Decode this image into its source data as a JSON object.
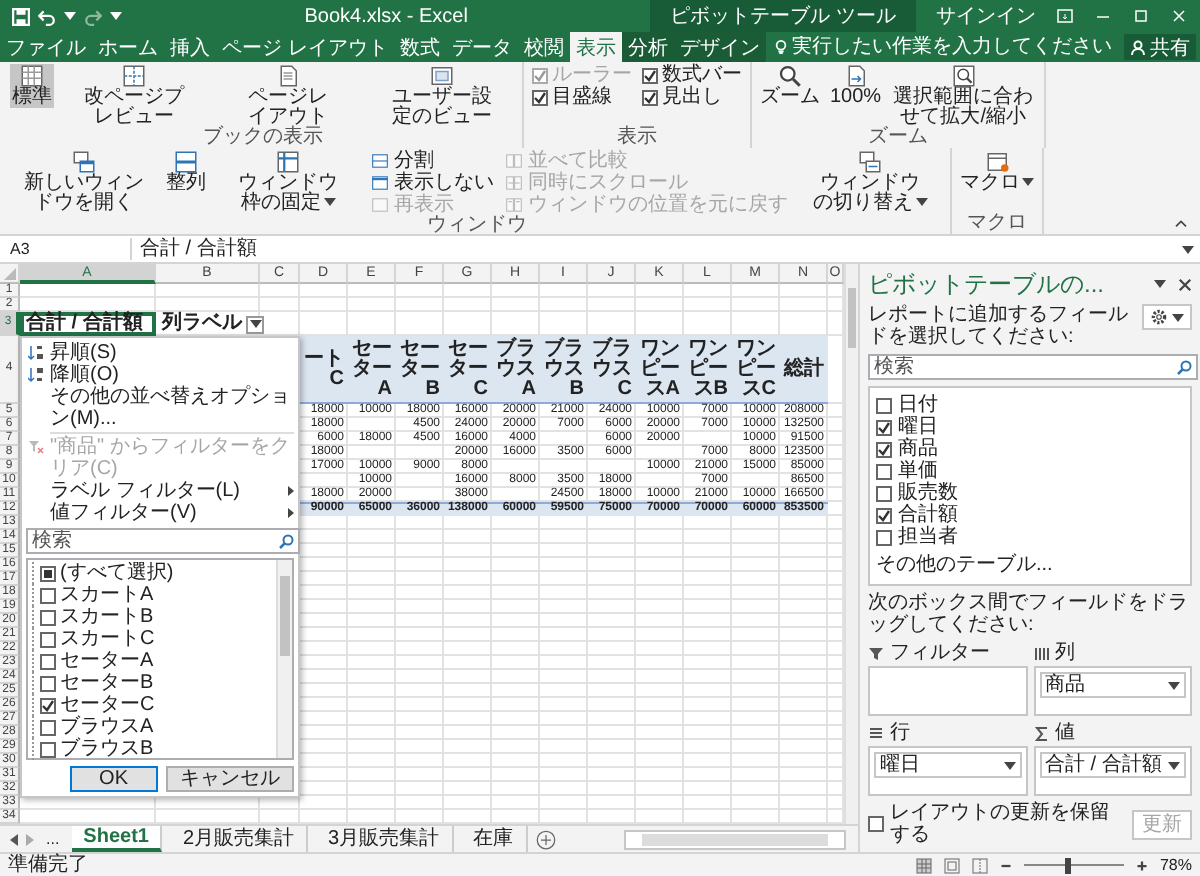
{
  "title_bar": {
    "title": "Book4.xlsx - Excel",
    "context": "ピボットテーブル ツール",
    "sign_in": "サインイン"
  },
  "tabs": [
    {
      "label": "ファイル",
      "selected": false,
      "contextual": false
    },
    {
      "label": "ホーム",
      "selected": false,
      "contextual": false
    },
    {
      "label": "挿入",
      "selected": false,
      "contextual": false
    },
    {
      "label": "ページ レイアウト",
      "selected": false,
      "contextual": false
    },
    {
      "label": "数式",
      "selected": false,
      "contextual": false
    },
    {
      "label": "データ",
      "selected": false,
      "contextual": false
    },
    {
      "label": "校閲",
      "selected": false,
      "contextual": false
    },
    {
      "label": "表示",
      "selected": true,
      "contextual": false
    },
    {
      "label": "分析",
      "selected": false,
      "contextual": true
    },
    {
      "label": "デザイン",
      "selected": false,
      "contextual": true
    }
  ],
  "tell_me": {
    "placeholder": "実行したい作業を入力してください"
  },
  "share": "共有",
  "ribbon_groups": [
    {
      "label": "ブックの表示",
      "items": [
        {
          "kind": "large",
          "label": "標準",
          "selected": true,
          "dropdown": false
        },
        {
          "kind": "large",
          "label": "改ページプレビュー",
          "selected": false,
          "dropdown": false
        },
        {
          "kind": "large",
          "label": "ページレイアウト",
          "selected": false,
          "dropdown": false
        },
        {
          "kind": "large",
          "label": "ユーザー設定のビュー",
          "selected": false,
          "dropdown": false
        }
      ]
    },
    {
      "label": "表示",
      "items": [
        {
          "kind": "checks",
          "items": [
            {
              "label": "ルーラー",
              "checked": true,
              "disabled": true
            },
            {
              "label": "目盛線",
              "checked": true,
              "disabled": false
            }
          ]
        },
        {
          "kind": "checks",
          "items": [
            {
              "label": "数式バー",
              "checked": true,
              "disabled": false
            },
            {
              "label": "見出し",
              "checked": true,
              "disabled": false
            }
          ]
        }
      ]
    },
    {
      "label": "ズーム",
      "items": [
        {
          "kind": "large",
          "label": "ズーム",
          "selected": false,
          "dropdown": false
        },
        {
          "kind": "large",
          "label": "100%",
          "selected": false,
          "dropdown": false
        },
        {
          "kind": "large",
          "label": "選択範囲に合わせて拡大/縮小",
          "selected": false,
          "dropdown": false
        }
      ]
    },
    {
      "label": "ウィンドウ",
      "items": [
        {
          "kind": "large",
          "label": "新しいウィンドウを開く",
          "selected": false,
          "dropdown": false
        },
        {
          "kind": "large",
          "label": "整列",
          "selected": false,
          "dropdown": false
        },
        {
          "kind": "large",
          "label": "ウィンドウ枠の固定",
          "selected": false,
          "dropdown": true
        },
        {
          "kind": "stack",
          "items": [
            {
              "label": "分割",
              "disabled": false
            },
            {
              "label": "表示しない",
              "disabled": false
            },
            {
              "label": "再表示",
              "disabled": true
            }
          ]
        },
        {
          "kind": "stack",
          "items": [
            {
              "label": "並べて比較",
              "disabled": true
            },
            {
              "label": "同時にスクロール",
              "disabled": true
            },
            {
              "label": "ウィンドウの位置を元に戻す",
              "disabled": true
            }
          ]
        },
        {
          "kind": "large",
          "label": "ウィンドウの切り替え",
          "selected": false,
          "dropdown": true
        }
      ]
    },
    {
      "label": "マクロ",
      "items": [
        {
          "kind": "large",
          "label": "マクロ",
          "selected": false,
          "dropdown": true
        }
      ]
    }
  ],
  "formula_bar": {
    "name_box": "A3",
    "formula": "合計 / 合計額"
  },
  "sheet": {
    "columns": [
      {
        "label": "A",
        "selected": true
      },
      {
        "label": "B",
        "selected": false
      },
      {
        "label": "C",
        "selected": false
      },
      {
        "label": "D",
        "selected": false
      },
      {
        "label": "E",
        "selected": false
      },
      {
        "label": "F",
        "selected": false
      },
      {
        "label": "G",
        "selected": false
      },
      {
        "label": "H",
        "selected": false
      },
      {
        "label": "I",
        "selected": false
      },
      {
        "label": "J",
        "selected": false
      },
      {
        "label": "K",
        "selected": false
      },
      {
        "label": "L",
        "selected": false
      },
      {
        "label": "M",
        "selected": false
      },
      {
        "label": "N",
        "selected": false
      },
      {
        "label": "O",
        "selected": false
      }
    ],
    "rows": [
      {
        "label": "1",
        "selected": false
      },
      {
        "label": "2",
        "selected": false
      },
      {
        "label": "3",
        "selected": true
      },
      {
        "label": "4",
        "selected": false
      },
      {
        "label": "5",
        "selected": false
      },
      {
        "label": "6",
        "selected": false
      },
      {
        "label": "7",
        "selected": false
      },
      {
        "label": "8",
        "selected": false
      },
      {
        "label": "9",
        "selected": false
      },
      {
        "label": "10",
        "selected": false
      },
      {
        "label": "11",
        "selected": false
      },
      {
        "label": "12",
        "selected": false
      },
      {
        "label": "13",
        "selected": false
      },
      {
        "label": "14",
        "selected": false
      },
      {
        "label": "15",
        "selected": false
      },
      {
        "label": "16",
        "selected": false
      },
      {
        "label": "17",
        "selected": false
      },
      {
        "label": "18",
        "selected": false
      },
      {
        "label": "19",
        "selected": false
      },
      {
        "label": "20",
        "selected": false
      },
      {
        "label": "21",
        "selected": false
      },
      {
        "label": "22",
        "selected": false
      },
      {
        "label": "23",
        "selected": false
      },
      {
        "label": "24",
        "selected": false
      },
      {
        "label": "25",
        "selected": false
      },
      {
        "label": "26",
        "selected": false
      },
      {
        "label": "27",
        "selected": false
      },
      {
        "label": "28",
        "selected": false
      },
      {
        "label": "29",
        "selected": false
      },
      {
        "label": "30",
        "selected": false
      },
      {
        "label": "31",
        "selected": false
      },
      {
        "label": "32",
        "selected": false
      },
      {
        "label": "33",
        "selected": false
      },
      {
        "label": "34",
        "selected": false
      }
    ],
    "pivot": {
      "corner": "合計 / 合計額",
      "column_labels": "列ラベル",
      "headers": [
        "ートC",
        "セーターA",
        "セーターB",
        "セーターC",
        "ブラウスA",
        "ブラウスB",
        "ブラウスC",
        "ワンピースA",
        "ワンピースB",
        "ワンピースC",
        "総計"
      ],
      "data": [
        {
          "D": "18000",
          "E": "10000",
          "F": "18000",
          "G": "16000",
          "H": "20000",
          "I": "21000",
          "J": "24000",
          "K": "10000",
          "L": "7000",
          "M": "10000",
          "N": "208000"
        },
        {
          "D": "18000",
          "F": "4500",
          "G": "24000",
          "H": "20000",
          "I": "7000",
          "J": "6000",
          "K": "20000",
          "L": "7000",
          "M": "10000",
          "N": "132500"
        },
        {
          "D": "6000",
          "E": "18000",
          "F": "4500",
          "G": "16000",
          "H": "4000",
          "J": "6000",
          "K": "20000",
          "M": "10000",
          "N": "91500"
        },
        {
          "D": "18000",
          "G": "20000",
          "H": "16000",
          "I": "3500",
          "J": "6000",
          "L": "7000",
          "M": "8000",
          "N": "123500"
        },
        {
          "D": "17000",
          "E": "10000",
          "F": "9000",
          "G": "8000",
          "K": "10000",
          "L": "21000",
          "M": "15000",
          "N": "85000"
        },
        {
          "E": "10000",
          "G": "16000",
          "H": "8000",
          "I": "3500",
          "J": "18000",
          "L": "7000",
          "N": "86500"
        },
        {
          "D": "18000",
          "E": "20000",
          "G": "38000",
          "I": "24500",
          "J": "18000",
          "K": "10000",
          "L": "21000",
          "M": "10000",
          "N": "166500"
        }
      ],
      "totals": [
        "90000",
        "65000",
        "36000",
        "138000",
        "60000",
        "59500",
        "75000",
        "70000",
        "70000",
        "60000",
        "853500"
      ]
    }
  },
  "filter_menu": {
    "items": [
      {
        "kind": "sort_asc",
        "label": "昇順(S)",
        "disabled": false
      },
      {
        "kind": "sort_desc",
        "label": "降順(O)",
        "disabled": false
      },
      {
        "kind": "plain",
        "label": "その他の並べ替えオプション(M)...",
        "disabled": false
      },
      {
        "kind": "clear",
        "label": "\"商品\" からフィルターをクリア(C)",
        "disabled": true
      },
      {
        "kind": "submenu",
        "label": "ラベル フィルター(L)",
        "disabled": false
      },
      {
        "kind": "submenu",
        "label": "値フィルター(V)",
        "disabled": false
      }
    ],
    "search": {
      "placeholder": "検索"
    },
    "options": [
      {
        "label": "(すべて選択)",
        "checked": false,
        "mixed": true
      },
      {
        "label": "スカートA",
        "checked": false,
        "mixed": false
      },
      {
        "label": "スカートB",
        "checked": false,
        "mixed": false
      },
      {
        "label": "スカートC",
        "checked": false,
        "mixed": false
      },
      {
        "label": "セーターA",
        "checked": false,
        "mixed": false
      },
      {
        "label": "セーターB",
        "checked": false,
        "mixed": false
      },
      {
        "label": "セーターC",
        "checked": true,
        "mixed": false
      },
      {
        "label": "ブラウスA",
        "checked": false,
        "mixed": false
      },
      {
        "label": "ブラウスB",
        "checked": false,
        "mixed": false
      }
    ],
    "buttons": [
      "OK",
      "キャンセル"
    ]
  },
  "sheet_tabs": {
    "more": "...",
    "tabs": [
      {
        "label": "Sheet1",
        "selected": true
      },
      {
        "label": "2月販売集計",
        "selected": false
      },
      {
        "label": "3月販売集計",
        "selected": false
      },
      {
        "label": "在庫",
        "selected": false
      }
    ]
  },
  "pivot_panel": {
    "title": "ピボットテーブルの...",
    "instruction": "レポートに追加するフィールドを選択してください:",
    "search": {
      "placeholder": "検索"
    },
    "fields": [
      {
        "label": "日付",
        "checked": false
      },
      {
        "label": "曜日",
        "checked": true
      },
      {
        "label": "商品",
        "checked": true
      },
      {
        "label": "単価",
        "checked": false
      },
      {
        "label": "販売数",
        "checked": false
      },
      {
        "label": "合計額",
        "checked": true
      },
      {
        "label": "担当者",
        "checked": false
      }
    ],
    "more_tables": "その他のテーブル...",
    "drag_hint": "次のボックス間でフィールドをドラッグしてください:",
    "areas": [
      {
        "label": "フィルター"
      },
      {
        "label": "列",
        "fields": [
          "商品"
        ]
      },
      {
        "label": "行",
        "fields": [
          "曜日"
        ]
      },
      {
        "label": "値",
        "fields": [
          "合計 / 合計額"
        ]
      }
    ],
    "defer": {
      "label": "レイアウトの更新を保留する",
      "checked": false
    },
    "update": {
      "label": "更新",
      "disabled": true
    }
  },
  "status_bar": {
    "text": "準備完了",
    "zoom": {
      "level": 0.45,
      "reading": "78%"
    }
  }
}
